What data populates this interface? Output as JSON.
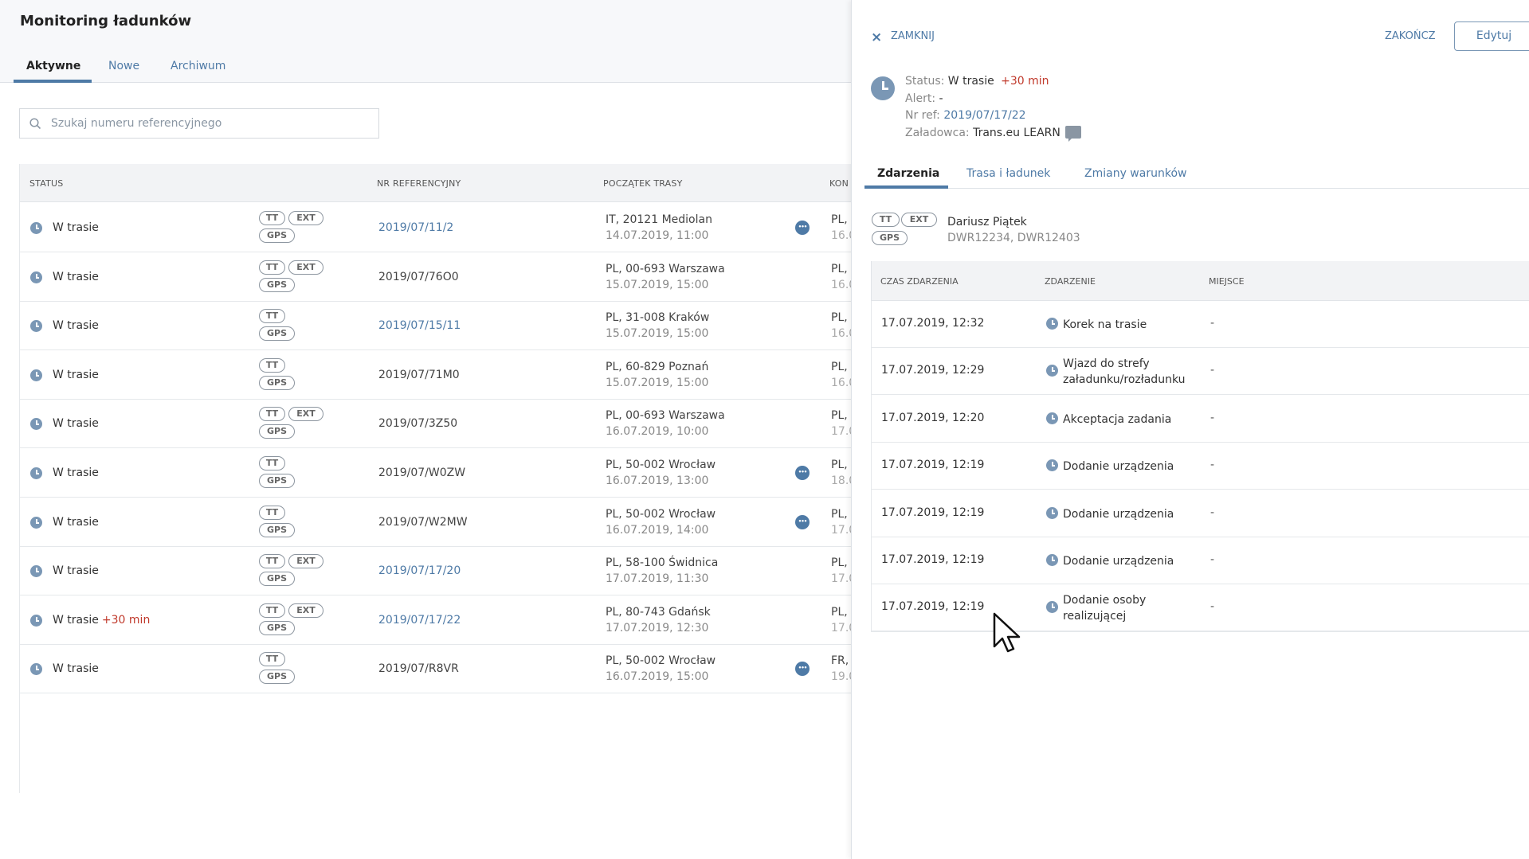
{
  "page": {
    "title": "Monitoring ładunków"
  },
  "main_tabs": [
    {
      "label": "Aktywne",
      "active": true
    },
    {
      "label": "Nowe",
      "active": false
    },
    {
      "label": "Archiwum",
      "active": false
    }
  ],
  "search": {
    "placeholder": "Szukaj numeru referencyjnego",
    "value": ""
  },
  "table": {
    "headers": {
      "status": "STATUS",
      "ref": "NR REFERENCYJNY",
      "start": "POCZĄTEK TRASY",
      "end": "KON"
    },
    "rows": [
      {
        "status": "W trasie",
        "delay": "",
        "tags": [
          "TT",
          "EXT",
          "GPS"
        ],
        "ref": "2019/07/11/2",
        "ref_link": true,
        "start_loc": "IT, 20121 Mediolan",
        "start_date": "14.07.2019, 11:00",
        "more": true,
        "end_loc": "PL,",
        "end_date": "16.0"
      },
      {
        "status": "W trasie",
        "delay": "",
        "tags": [
          "TT",
          "EXT",
          "GPS"
        ],
        "ref": "2019/07/76O0",
        "ref_link": false,
        "start_loc": "PL, 00-693 Warszawa",
        "start_date": "15.07.2019, 15:00",
        "more": false,
        "end_loc": "PL,",
        "end_date": "16.0"
      },
      {
        "status": "W trasie",
        "delay": "",
        "tags": [
          "TT",
          "GPS"
        ],
        "ref": "2019/07/15/11",
        "ref_link": true,
        "start_loc": "PL, 31-008 Kraków",
        "start_date": "15.07.2019, 15:00",
        "more": false,
        "end_loc": "PL,",
        "end_date": "16.0"
      },
      {
        "status": "W trasie",
        "delay": "",
        "tags": [
          "TT",
          "GPS"
        ],
        "ref": "2019/07/71M0",
        "ref_link": false,
        "start_loc": "PL, 60-829 Poznań",
        "start_date": "15.07.2019, 15:00",
        "more": false,
        "end_loc": "PL,",
        "end_date": "16.0"
      },
      {
        "status": "W trasie",
        "delay": "",
        "tags": [
          "TT",
          "EXT",
          "GPS"
        ],
        "ref": "2019/07/3Z50",
        "ref_link": false,
        "start_loc": "PL, 00-693 Warszawa",
        "start_date": "16.07.2019, 10:00",
        "more": false,
        "end_loc": "PL,",
        "end_date": "17.0"
      },
      {
        "status": "W trasie",
        "delay": "",
        "tags": [
          "TT",
          "GPS"
        ],
        "ref": "2019/07/W0ZW",
        "ref_link": false,
        "start_loc": "PL, 50-002 Wrocław",
        "start_date": "16.07.2019, 13:00",
        "more": true,
        "end_loc": "PL,",
        "end_date": "18.0"
      },
      {
        "status": "W trasie",
        "delay": "",
        "tags": [
          "TT",
          "GPS"
        ],
        "ref": "2019/07/W2MW",
        "ref_link": false,
        "start_loc": "PL, 50-002 Wrocław",
        "start_date": "16.07.2019, 14:00",
        "more": true,
        "end_loc": "PL,",
        "end_date": "17.0"
      },
      {
        "status": "W trasie",
        "delay": "",
        "tags": [
          "TT",
          "EXT",
          "GPS"
        ],
        "ref": "2019/07/17/20",
        "ref_link": true,
        "start_loc": "PL, 58-100 Świdnica",
        "start_date": "17.07.2019, 11:30",
        "more": false,
        "end_loc": "PL,",
        "end_date": "17.0"
      },
      {
        "status": "W trasie",
        "delay": "+30 min",
        "tags": [
          "TT",
          "EXT",
          "GPS"
        ],
        "ref": "2019/07/17/22",
        "ref_link": true,
        "start_loc": "PL, 80-743 Gdańsk",
        "start_date": "17.07.2019, 12:30",
        "more": false,
        "end_loc": "PL,",
        "end_date": "17.0"
      },
      {
        "status": "W trasie",
        "delay": "",
        "tags": [
          "TT",
          "GPS"
        ],
        "ref": "2019/07/R8VR",
        "ref_link": false,
        "start_loc": "PL, 50-002 Wrocław",
        "start_date": "16.07.2019, 15:00",
        "more": true,
        "end_loc": "FR,",
        "end_date": "19.0"
      }
    ]
  },
  "panel": {
    "close_label": "ZAMKNIJ",
    "finish_label": "ZAKOŃCZ",
    "edit_label": "Edytuj",
    "status_label": "Status:",
    "status_value": "W trasie",
    "status_delay": "+30 min",
    "alert_label": "Alert:",
    "alert_value": "-",
    "ref_label": "Nr ref:",
    "ref_value": "2019/07/17/22",
    "shipper_label": "Załadowca:",
    "shipper_value": "Trans.eu LEARN",
    "tabs": [
      {
        "label": "Zdarzenia",
        "active": true
      },
      {
        "label": "Trasa i ładunek",
        "active": false
      },
      {
        "label": "Zmiany warunków",
        "active": false
      }
    ],
    "driver": {
      "tags": [
        "TT",
        "EXT",
        "GPS"
      ],
      "name": "Dariusz Piątek",
      "vehicles": "DWR12234, DWR12403"
    },
    "events": {
      "headers": {
        "time": "CZAS ZDARZENIA",
        "event": "ZDARZENIE",
        "place": "MIEJSCE"
      },
      "rows": [
        {
          "time": "17.07.2019, 12:32",
          "event_line1": "Korek na trasie",
          "event_line2": "",
          "place": "-"
        },
        {
          "time": "17.07.2019, 12:29",
          "event_line1": "Wjazd do strefy",
          "event_line2": "załadunku/rozładunku",
          "place": "-"
        },
        {
          "time": "17.07.2019, 12:20",
          "event_line1": "Akceptacja zadania",
          "event_line2": "",
          "place": "-"
        },
        {
          "time": "17.07.2019, 12:19",
          "event_line1": "Dodanie urządzenia",
          "event_line2": "",
          "place": "-"
        },
        {
          "time": "17.07.2019, 12:19",
          "event_line1": "Dodanie urządzenia",
          "event_line2": "",
          "place": "-"
        },
        {
          "time": "17.07.2019, 12:19",
          "event_line1": "Dodanie urządzenia",
          "event_line2": "",
          "place": "-"
        },
        {
          "time": "17.07.2019, 12:19",
          "event_line1": "Dodanie osoby",
          "event_line2": "realizującej",
          "place": "-"
        }
      ]
    }
  },
  "colors": {
    "accent": "#4e7aa6",
    "delay": "#c0392b",
    "icon": "#7a97b5"
  },
  "icons": [
    "search-icon",
    "clock-icon",
    "more-icon",
    "close-icon",
    "comment-icon",
    "cursor-icon"
  ]
}
